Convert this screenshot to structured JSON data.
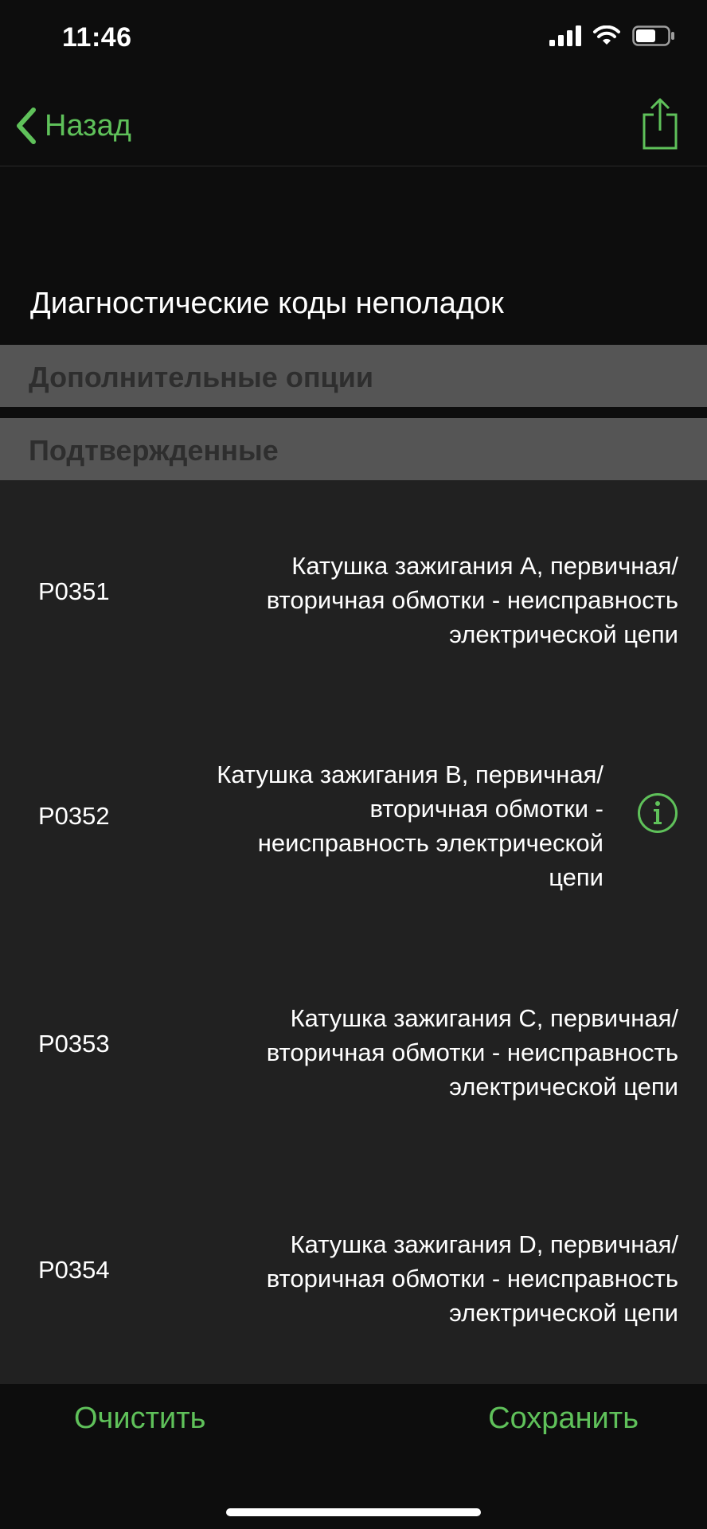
{
  "status_bar": {
    "time": "11:46",
    "icons": [
      "cellular-signal-icon",
      "wifi-icon",
      "battery-icon"
    ]
  },
  "nav": {
    "back_label": "Назад",
    "back_icon": "chevron-left-icon",
    "share_icon": "share-icon"
  },
  "page": {
    "title": "Диагностические коды неполадок"
  },
  "sections": {
    "options_label": "Дополнительные опции",
    "confirmed_label": "Подтвержденные"
  },
  "dtc_list": [
    {
      "code": "P0351",
      "lines": [
        "Катушка зажигания A, первичная/",
        "вторичная обмотки - неисправность",
        "электрической цепи"
      ]
    },
    {
      "code": "P0352",
      "lines": [
        "Катушка зажигания B, первичная/",
        "вторичная обмотки -",
        "неисправность электрической",
        "цепи"
      ],
      "has_info": true
    },
    {
      "code": "P0353",
      "lines": [
        "Катушка зажигания C, первичная/",
        "вторичная обмотки - неисправность",
        "электрической цепи"
      ]
    },
    {
      "code": "P0354",
      "lines": [
        "Катушка зажигания D, первичная/",
        "вторичная обмотки - неисправность",
        "электрической цепи"
      ]
    }
  ],
  "bottom_bar": {
    "clear_label": "Очистить",
    "save_label": "Сохранить"
  },
  "colors": {
    "accent": "#5fc15a",
    "background": "#0d0d0d",
    "list_background": "#212121",
    "section_background": "#555555"
  }
}
